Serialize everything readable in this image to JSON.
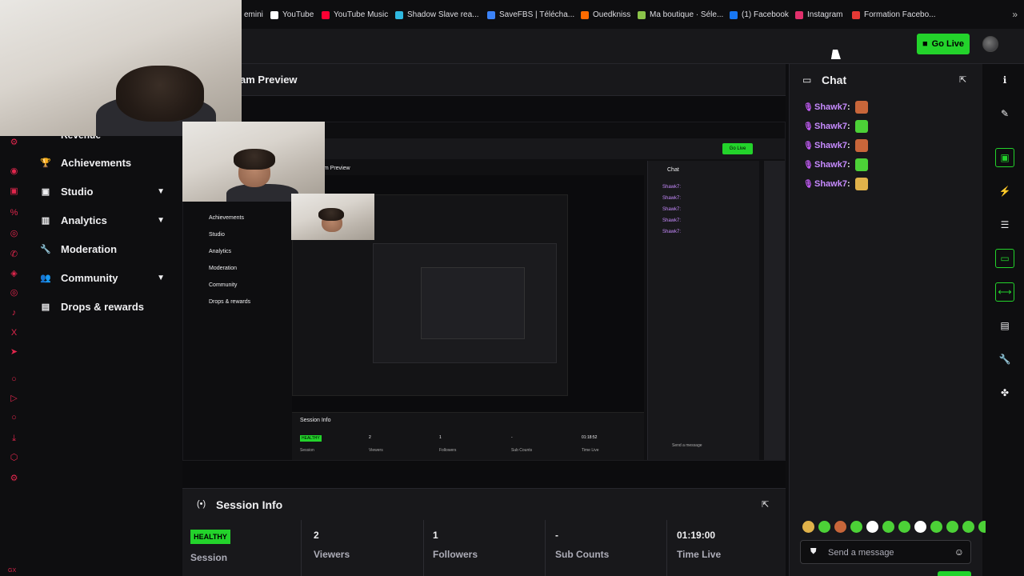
{
  "bookmarks": [
    {
      "label": "emini",
      "color": "#4285f4"
    },
    {
      "label": "YouTube",
      "color": "#ffffff"
    },
    {
      "label": "YouTube Music",
      "color": "#ff0033"
    },
    {
      "label": "Shadow Slave rea...",
      "color": "#2fb8e0"
    },
    {
      "label": "SaveFBS | Télécha...",
      "color": "#3b82f6"
    },
    {
      "label": "Ouedkniss",
      "color": "#ff6b00"
    },
    {
      "label": "Ma boutique · Séle...",
      "color": "#8bc34a"
    },
    {
      "label": "(1) Facebook",
      "color": "#1877f2"
    },
    {
      "label": "Instagram",
      "color": "#e1306c"
    },
    {
      "label": "Formation Facebo...",
      "color": "#e53935"
    }
  ],
  "topbar": {
    "go_live_label": "Go Live",
    "accent": "#23d32b"
  },
  "nav": {
    "cut_label": "Revenue",
    "items": [
      {
        "label": "Achievements",
        "icon": "trophy-icon",
        "glyph": "🏆",
        "chevron": false
      },
      {
        "label": "Studio",
        "icon": "studio-icon",
        "glyph": "▣",
        "chevron": true
      },
      {
        "label": "Analytics",
        "icon": "analytics-icon",
        "glyph": "▥",
        "chevron": true
      },
      {
        "label": "Moderation",
        "icon": "wrench-icon",
        "glyph": "🔧",
        "chevron": false
      },
      {
        "label": "Community",
        "icon": "community-icon",
        "glyph": "👥",
        "chevron": true
      },
      {
        "label": "Drops & rewards",
        "icon": "drops-icon",
        "glyph": "▤",
        "chevron": false
      }
    ]
  },
  "preview": {
    "title": "am Preview"
  },
  "nested_preview": {
    "chat_title": "Chat",
    "preview_title": "am Preview",
    "session_title": "Session Info",
    "go_live": "Go Live",
    "nav": [
      "Achievements",
      "Studio",
      "Analytics",
      "Moderation",
      "Community",
      "Drops & rewards"
    ],
    "messages": [
      "Shawk7:",
      "Shawk7:",
      "Shawk7:",
      "Shawk7:",
      "Shawk7:"
    ],
    "stats": [
      {
        "value": "HEALTHY",
        "label": "Session"
      },
      {
        "value": "2",
        "label": "Viewers"
      },
      {
        "value": "1",
        "label": "Followers"
      },
      {
        "value": "-",
        "label": "Sub Counts"
      },
      {
        "value": "01:18:52",
        "label": "Time Live"
      }
    ],
    "placeholder": "Send a message"
  },
  "session": {
    "title": "Session Info",
    "stats": [
      {
        "value": "HEALTHY",
        "label": "Session"
      },
      {
        "value": "2",
        "label": "Viewers"
      },
      {
        "value": "1",
        "label": "Followers"
      },
      {
        "value": "-",
        "label": "Sub Counts"
      },
      {
        "value": "01:19:00",
        "label": "Time Live"
      }
    ]
  },
  "chat": {
    "title": "Chat",
    "messages": [
      {
        "user": "Shawk7",
        "emote_color": "#c8663a"
      },
      {
        "user": "Shawk7",
        "emote_color": "#4cd137"
      },
      {
        "user": "Shawk7",
        "emote_color": "#c8663a"
      },
      {
        "user": "Shawk7",
        "emote_color": "#4cd137"
      },
      {
        "user": "Shawk7",
        "emote_color": "#e0b24a"
      }
    ],
    "placeholder": "Send a message",
    "emote_bar": [
      "#e0b24a",
      "#4cd137",
      "#c8663a",
      "#4cd137",
      "#ffffff",
      "#4cd137",
      "#4cd137",
      "#ffffff",
      "#4cd137",
      "#4cd137",
      "#4cd137",
      "#4cd137"
    ]
  },
  "right_rail": [
    {
      "name": "info-icon",
      "glyph": "ℹ",
      "boxed": false
    },
    {
      "name": "pencil-icon",
      "glyph": "✎",
      "boxed": false
    },
    {
      "name": "layout-icon",
      "glyph": "▣",
      "boxed": true
    },
    {
      "name": "lightning-icon",
      "glyph": "⚡",
      "boxed": false
    },
    {
      "name": "list-icon",
      "glyph": "☰",
      "boxed": false
    },
    {
      "name": "chat-icon",
      "glyph": "▭",
      "boxed": true
    },
    {
      "name": "broadcast-icon",
      "glyph": "⟷",
      "boxed": true
    },
    {
      "name": "server-icon",
      "glyph": "▤",
      "boxed": false
    },
    {
      "name": "wrench-icon",
      "glyph": "🔧",
      "boxed": false
    },
    {
      "name": "extensions-icon",
      "glyph": "✤",
      "boxed": false
    }
  ]
}
